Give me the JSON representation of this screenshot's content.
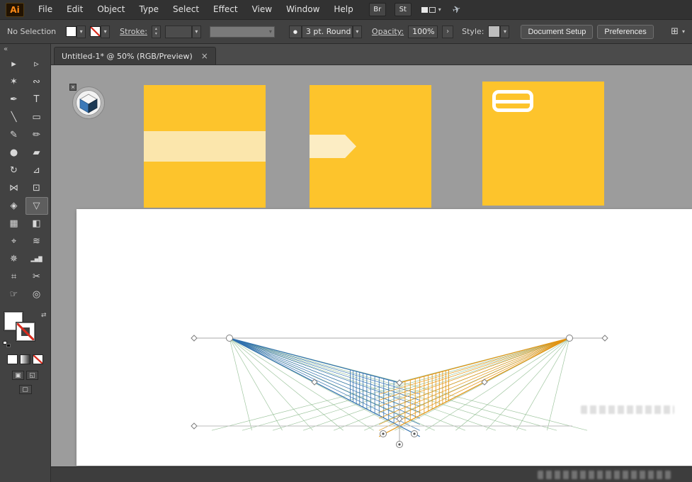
{
  "menubar": {
    "logo": "Ai",
    "menus": [
      "File",
      "Edit",
      "Object",
      "Type",
      "Select",
      "Effect",
      "View",
      "Window",
      "Help"
    ],
    "bridge_label": "Br",
    "stock_label": "St"
  },
  "controlbar": {
    "selection_status": "No Selection",
    "stroke_label": "Stroke:",
    "brush_dot": "●",
    "brush_name": "3 pt. Round",
    "opacity_label": "Opacity:",
    "opacity_value": "100%",
    "opacity_arrow": "›",
    "style_label": "Style:",
    "document_setup_label": "Document Setup",
    "preferences_label": "Preferences",
    "align_glyph": "⊞"
  },
  "tabbar": {
    "document_tab": "Untitled-1* @ 50% (RGB/Preview)",
    "close_glyph": "×"
  },
  "toolbar": {
    "collapse_glyph": "«",
    "swap_glyph": "⇄",
    "tools": [
      {
        "name": "selection-tool",
        "glyph": "▸"
      },
      {
        "name": "direct-selection-tool",
        "glyph": "▹"
      },
      {
        "name": "magic-wand-tool",
        "glyph": "✶"
      },
      {
        "name": "lasso-tool",
        "glyph": "∾"
      },
      {
        "name": "pen-tool",
        "glyph": "✒"
      },
      {
        "name": "type-tool",
        "glyph": "T"
      },
      {
        "name": "line-segment-tool",
        "glyph": "╲"
      },
      {
        "name": "rectangle-tool",
        "glyph": "▭"
      },
      {
        "name": "paintbrush-tool",
        "glyph": "✎"
      },
      {
        "name": "pencil-tool",
        "glyph": "✏"
      },
      {
        "name": "blob-brush-tool",
        "glyph": "●"
      },
      {
        "name": "eraser-tool",
        "glyph": "▰"
      },
      {
        "name": "rotate-tool",
        "glyph": "↻"
      },
      {
        "name": "scale-tool",
        "glyph": "⊿"
      },
      {
        "name": "width-tool",
        "glyph": "⋈"
      },
      {
        "name": "free-transform-tool",
        "glyph": "⊡"
      },
      {
        "name": "shape-builder-tool",
        "glyph": "◈"
      },
      {
        "name": "perspective-grid-tool",
        "glyph": "▽",
        "active": true
      },
      {
        "name": "mesh-tool",
        "glyph": "▦"
      },
      {
        "name": "gradient-tool",
        "glyph": "◧"
      },
      {
        "name": "eyedropper-tool",
        "glyph": "⌖"
      },
      {
        "name": "blend-tool",
        "glyph": "≋"
      },
      {
        "name": "symbol-sprayer-tool",
        "glyph": "✵"
      },
      {
        "name": "column-graph-tool",
        "glyph": "▂▅█"
      },
      {
        "name": "artboard-tool",
        "glyph": "⌗"
      },
      {
        "name": "slice-tool",
        "glyph": "✂"
      },
      {
        "name": "hand-tool",
        "glyph": "☞"
      },
      {
        "name": "zoom-tool",
        "glyph": "◎"
      }
    ]
  },
  "canvas": {
    "swatch_color": "#FDC42C",
    "stripe_color": "#FBE6AC",
    "flag_color": "#FCEDC4"
  },
  "perspective_grid": {
    "left_plane_color": "#2e6fae",
    "right_plane_color": "#e2930f",
    "floor_color": "#8fbc8f",
    "line_color": "#a8a8a8"
  }
}
